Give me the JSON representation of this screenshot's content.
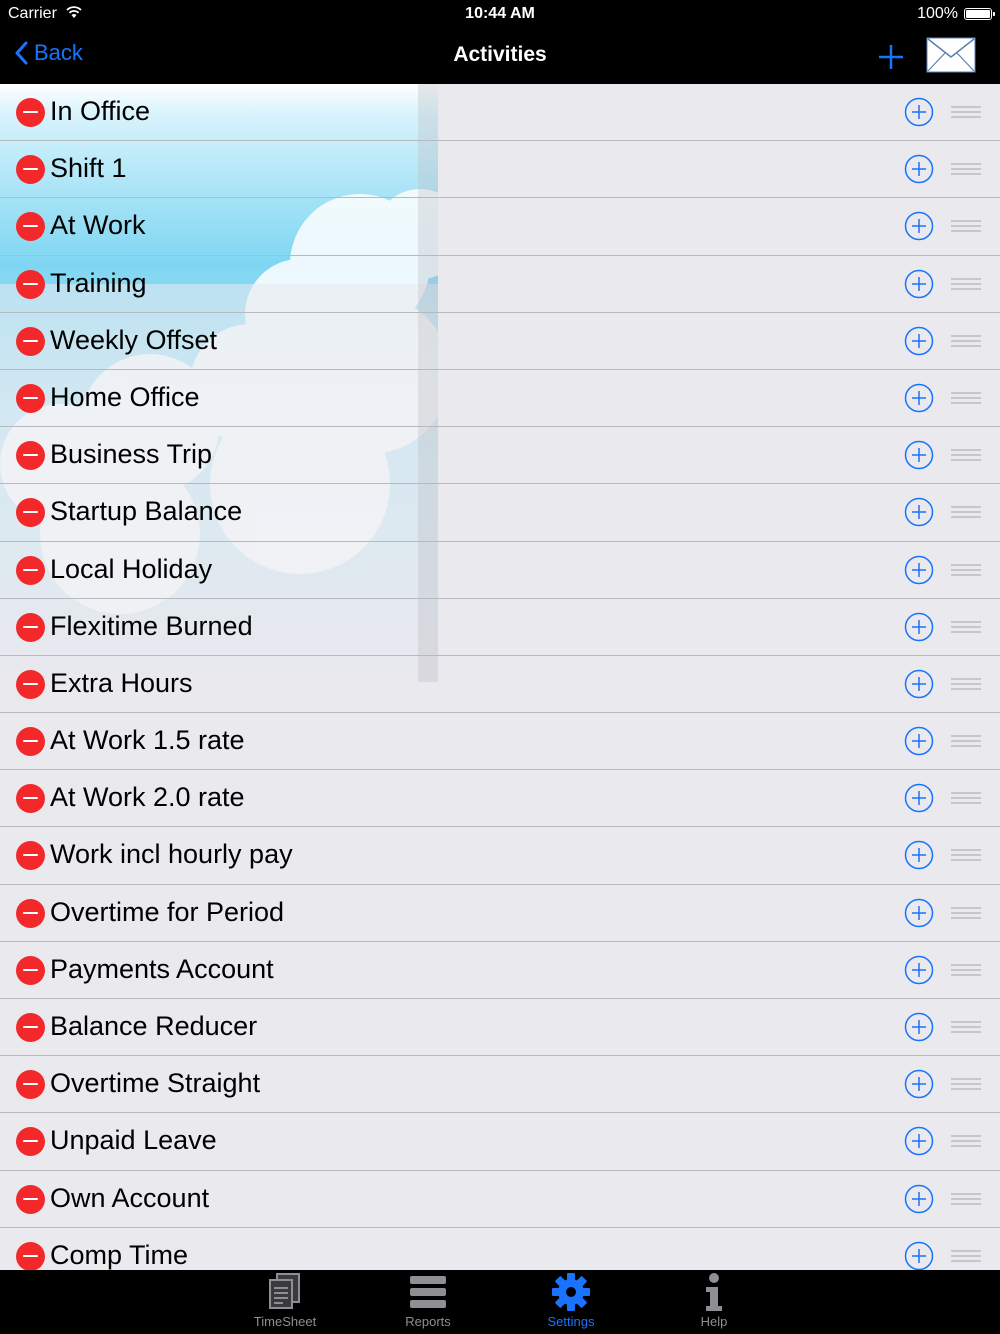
{
  "status_bar": {
    "carrier": "Carrier",
    "time": "10:44 AM",
    "battery": "100%"
  },
  "nav": {
    "back_label": "Back",
    "title": "Activities"
  },
  "activities": [
    "In Office",
    "Shift 1",
    "At Work",
    "Training",
    "Weekly Offset",
    "Home Office",
    "Business Trip",
    "Startup Balance",
    "Local Holiday",
    "Flexitime Burned",
    "Extra Hours",
    "At Work 1.5 rate",
    "At Work 2.0 rate",
    "Work incl hourly pay",
    "Overtime for Period",
    "Payments Account",
    "Balance Reducer",
    "Overtime Straight",
    "Unpaid Leave",
    "Own Account",
    "Comp Time"
  ],
  "tabs": [
    {
      "label": "TimeSheet",
      "icon": "timesheet-icon",
      "active": false
    },
    {
      "label": "Reports",
      "icon": "reports-icon",
      "active": false
    },
    {
      "label": "Settings",
      "icon": "gear-icon",
      "active": true
    },
    {
      "label": "Help",
      "icon": "info-icon",
      "active": false
    }
  ],
  "colors": {
    "accent": "#1a73ff",
    "delete": "#f2282b",
    "bar": "#000000",
    "list_bg": "#e9e9ee"
  }
}
